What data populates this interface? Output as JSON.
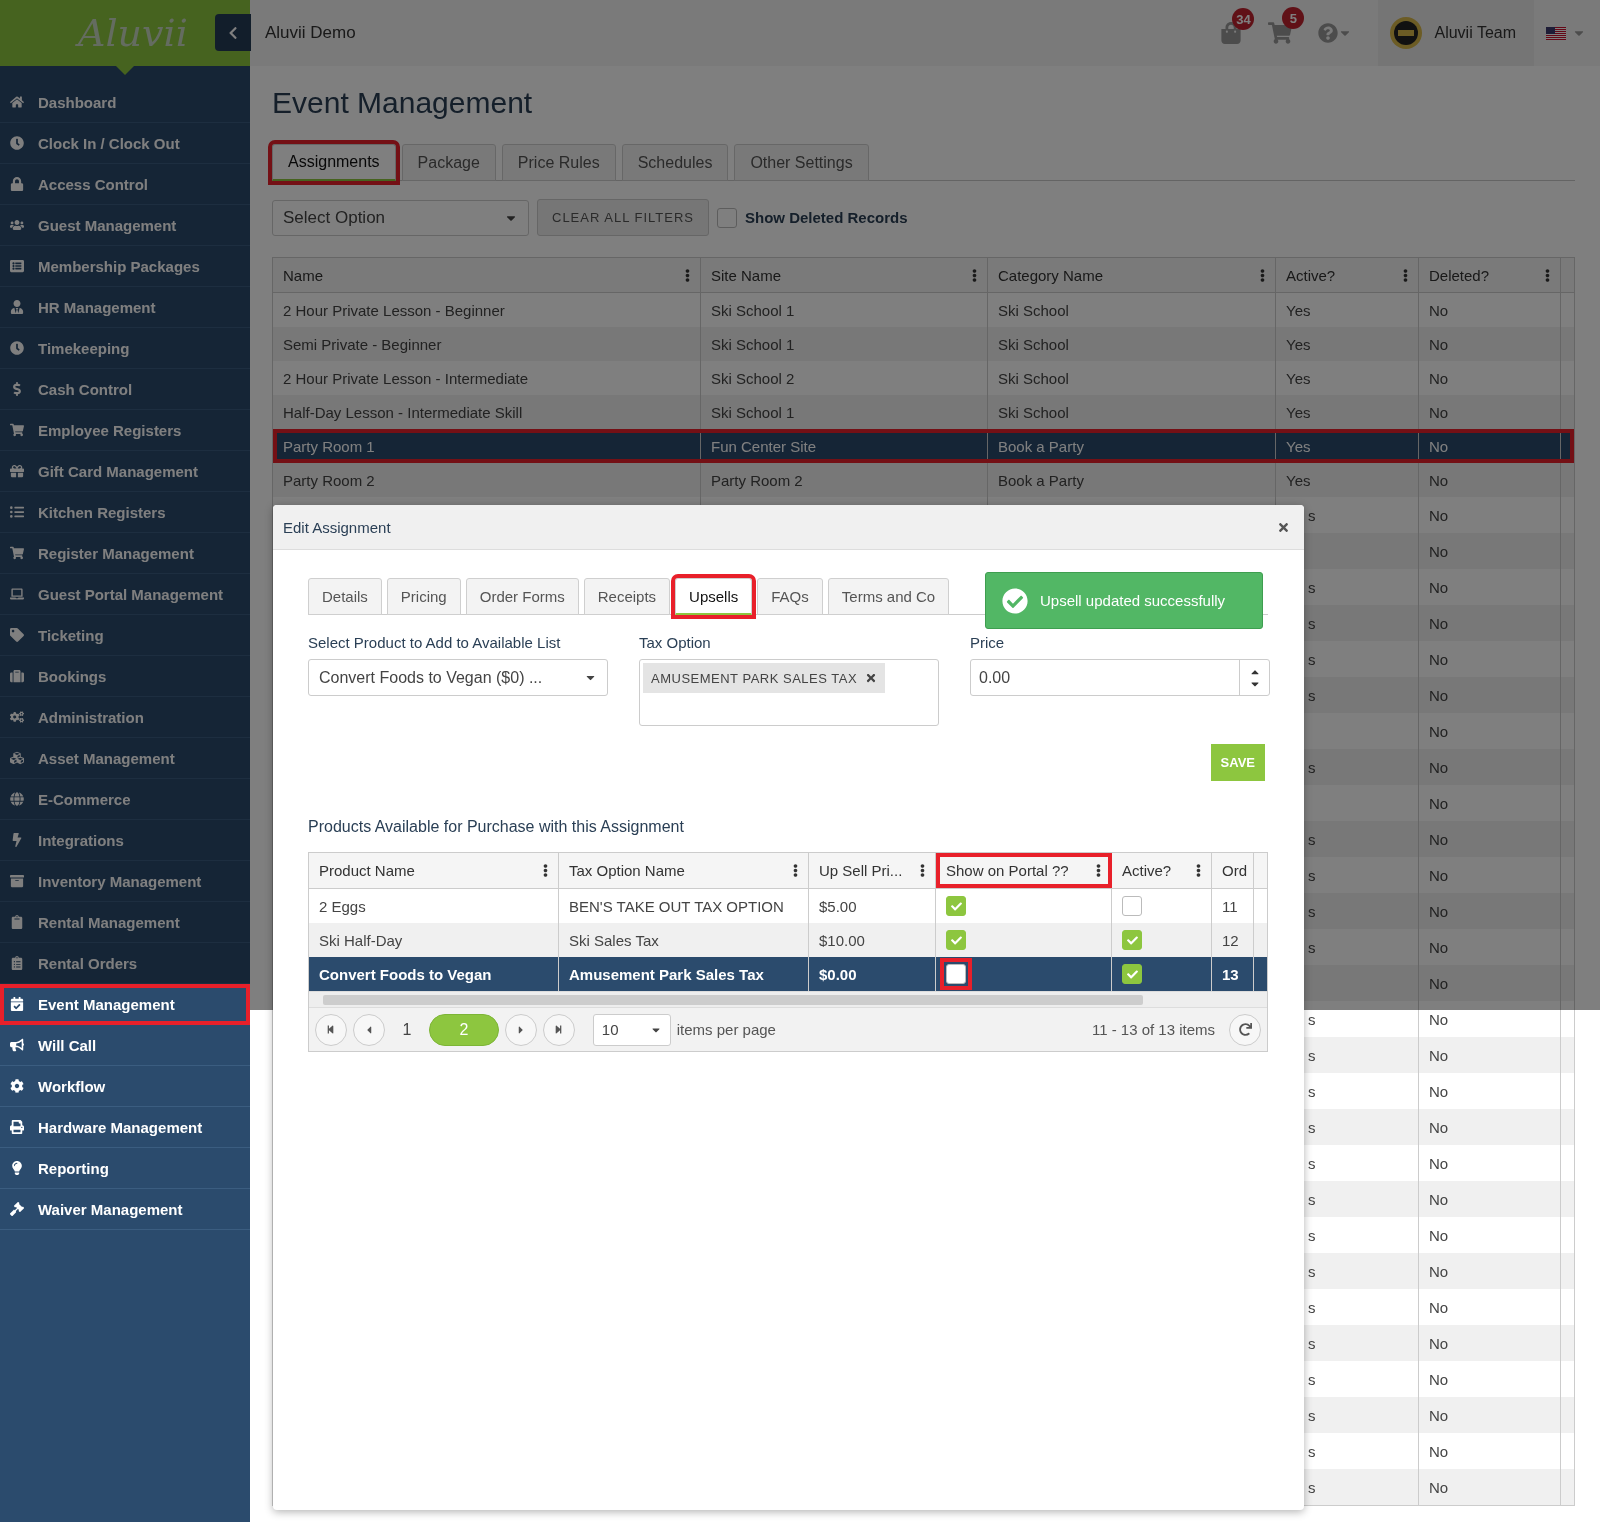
{
  "logo": {
    "text": "Aluvii"
  },
  "header": {
    "title": "Aluvii Demo",
    "notifications_badge": "34",
    "cart_badge": "5",
    "user_name": "Aluvii Team"
  },
  "sidebar": {
    "items": [
      {
        "label": "Dashboard",
        "highlighted": false
      },
      {
        "label": "Clock In / Clock Out",
        "highlighted": false
      },
      {
        "label": "Access Control",
        "highlighted": false
      },
      {
        "label": "Guest Management",
        "highlighted": false
      },
      {
        "label": "Membership Packages",
        "highlighted": false
      },
      {
        "label": "HR Management",
        "highlighted": false
      },
      {
        "label": "Timekeeping",
        "highlighted": false
      },
      {
        "label": "Cash Control",
        "highlighted": false
      },
      {
        "label": "Employee Registers",
        "highlighted": false
      },
      {
        "label": "Gift Card Management",
        "highlighted": false
      },
      {
        "label": "Kitchen Registers",
        "highlighted": false
      },
      {
        "label": "Register Management",
        "highlighted": false
      },
      {
        "label": "Guest Portal Management",
        "highlighted": false
      },
      {
        "label": "Ticketing",
        "highlighted": false
      },
      {
        "label": "Bookings",
        "highlighted": false
      },
      {
        "label": "Administration",
        "highlighted": false
      },
      {
        "label": "Asset Management",
        "highlighted": false
      },
      {
        "label": "E-Commerce",
        "highlighted": false
      },
      {
        "label": "Integrations",
        "highlighted": false
      },
      {
        "label": "Inventory Management",
        "highlighted": false
      },
      {
        "label": "Rental Management",
        "highlighted": false
      },
      {
        "label": "Rental Orders",
        "highlighted": false
      },
      {
        "label": "Event Management",
        "highlighted": true
      },
      {
        "label": "Will Call",
        "highlighted": false
      },
      {
        "label": "Workflow",
        "highlighted": false
      },
      {
        "label": "Hardware Management",
        "highlighted": false
      },
      {
        "label": "Reporting",
        "highlighted": false
      },
      {
        "label": "Waiver Management",
        "highlighted": false
      }
    ]
  },
  "page": {
    "title": "Event Management",
    "tabs": [
      {
        "label": "Assignments",
        "selected": true,
        "highlighted": true
      },
      {
        "label": "Package",
        "selected": false,
        "highlighted": false
      },
      {
        "label": "Price Rules",
        "selected": false,
        "highlighted": false
      },
      {
        "label": "Schedules",
        "selected": false,
        "highlighted": false
      },
      {
        "label": "Other Settings",
        "selected": false,
        "highlighted": false
      }
    ],
    "filters": {
      "select_value": "Select Option",
      "clear_button": "CLEAR ALL FILTERS",
      "show_deleted": {
        "label": "Show Deleted Records",
        "checked": false
      }
    },
    "table": {
      "columns": [
        "Name",
        "Site Name",
        "Category Name",
        "Active?",
        "Deleted?"
      ],
      "rows": [
        {
          "cells": [
            "2 Hour Private Lesson - Beginner",
            "Ski School 1",
            "Ski School",
            "Yes",
            "No"
          ],
          "selected": false,
          "highlighted": false
        },
        {
          "cells": [
            "Semi Private - Beginner",
            "Ski School 1",
            "Ski School",
            "Yes",
            "No"
          ],
          "selected": false,
          "highlighted": false
        },
        {
          "cells": [
            "2 Hour Private Lesson - Intermediate",
            "Ski School 2",
            "Ski School",
            "Yes",
            "No"
          ],
          "selected": false,
          "highlighted": false
        },
        {
          "cells": [
            "Half-Day Lesson - Intermediate Skill",
            "Ski School 1",
            "Ski School",
            "Yes",
            "No"
          ],
          "selected": false,
          "highlighted": false
        },
        {
          "cells": [
            "Party Room 1",
            "Fun Center Site",
            "Book a Party",
            "Yes",
            "No"
          ],
          "selected": true,
          "highlighted": true
        },
        {
          "cells": [
            "Party Room 2",
            "Party Room 2",
            "Book a Party",
            "Yes",
            "No"
          ],
          "selected": false,
          "highlighted": false
        }
      ],
      "rows_behind_modal": [
        {
          "active": "s",
          "deleted": "No"
        },
        {
          "deleted": "No"
        },
        {
          "active": "s",
          "deleted": "No"
        },
        {
          "active": "s",
          "deleted": "No"
        },
        {
          "active": "s",
          "deleted": "No"
        },
        {
          "active": "s",
          "deleted": "No"
        },
        {
          "deleted": "No"
        },
        {
          "active": "s",
          "deleted": "No"
        },
        {
          "deleted": "No"
        },
        {
          "active": "s",
          "deleted": "No"
        },
        {
          "active": "s",
          "deleted": "No"
        },
        {
          "active": "s",
          "deleted": "No"
        },
        {
          "active": "s",
          "deleted": "No"
        },
        {
          "deleted": "No"
        },
        {
          "active": "s",
          "deleted": "No"
        },
        {
          "active": "s",
          "deleted": "No"
        },
        {
          "active": "s",
          "deleted": "No"
        },
        {
          "active": "s",
          "deleted": "No"
        },
        {
          "active": "s",
          "deleted": "No"
        },
        {
          "active": "s",
          "deleted": "No"
        },
        {
          "active": "s",
          "deleted": "No"
        },
        {
          "active": "s",
          "deleted": "No"
        },
        {
          "active": "s",
          "deleted": "No"
        },
        {
          "active": "s",
          "deleted": "No"
        },
        {
          "active": "s",
          "deleted": "No"
        },
        {
          "active": "s",
          "deleted": "No"
        },
        {
          "active": "s",
          "deleted": "No"
        },
        {
          "active": "s",
          "deleted": "No"
        }
      ]
    }
  },
  "modal": {
    "title": "Edit Assignment",
    "tabs": [
      {
        "label": "Details",
        "selected": false,
        "highlighted": false
      },
      {
        "label": "Pricing",
        "selected": false,
        "highlighted": false
      },
      {
        "label": "Order Forms",
        "selected": false,
        "highlighted": false
      },
      {
        "label": "Receipts",
        "selected": false,
        "highlighted": false
      },
      {
        "label": "Upsells",
        "selected": true,
        "highlighted": true
      },
      {
        "label": "FAQs",
        "selected": false,
        "highlighted": false
      },
      {
        "label": "Terms and Co",
        "selected": false,
        "highlighted": false
      }
    ],
    "toast": {
      "message": "Upsell updated successfully"
    },
    "form": {
      "product": {
        "label": "Select Product to Add to Available List",
        "value": "Convert Foods to Vegan ($0) ..."
      },
      "tax": {
        "label": "Tax Option",
        "tags": [
          "AMUSEMENT PARK SALES TAX"
        ]
      },
      "price": {
        "label": "Price",
        "value": "0.00"
      },
      "save_button": "SAVE"
    },
    "products": {
      "title": "Products Available for Purchase with this Assignment",
      "columns": [
        {
          "label": "Product Name",
          "highlighted": false
        },
        {
          "label": "Tax Option Name",
          "highlighted": false
        },
        {
          "label": "Up Sell Pri...",
          "highlighted": false
        },
        {
          "label": "Show on Portal ??",
          "highlighted": true
        },
        {
          "label": "Active?",
          "highlighted": false
        },
        {
          "label": "Ord",
          "highlighted": false
        }
      ],
      "rows": [
        {
          "product": "2 Eggs",
          "tax": "BEN'S TAKE OUT TAX OPTION",
          "price": "$5.00",
          "show_on_portal": true,
          "portal_highlighted": false,
          "active": false,
          "order": "11",
          "selected": false
        },
        {
          "product": "Ski Half-Day",
          "tax": "Ski Sales Tax",
          "price": "$10.00",
          "show_on_portal": true,
          "portal_highlighted": false,
          "active": true,
          "order": "12",
          "selected": false
        },
        {
          "product": "Convert Foods to Vegan",
          "tax": "Amusement Park Sales Tax",
          "price": "$0.00",
          "show_on_portal": false,
          "portal_highlighted": true,
          "active": true,
          "order": "13",
          "selected": true
        }
      ],
      "pager": {
        "pages": [
          {
            "label": "1",
            "selected": false
          },
          {
            "label": "2",
            "selected": true
          }
        ],
        "page_size": "10",
        "page_size_label": "items per page",
        "summary": "11 - 13 of 13 items"
      }
    }
  }
}
